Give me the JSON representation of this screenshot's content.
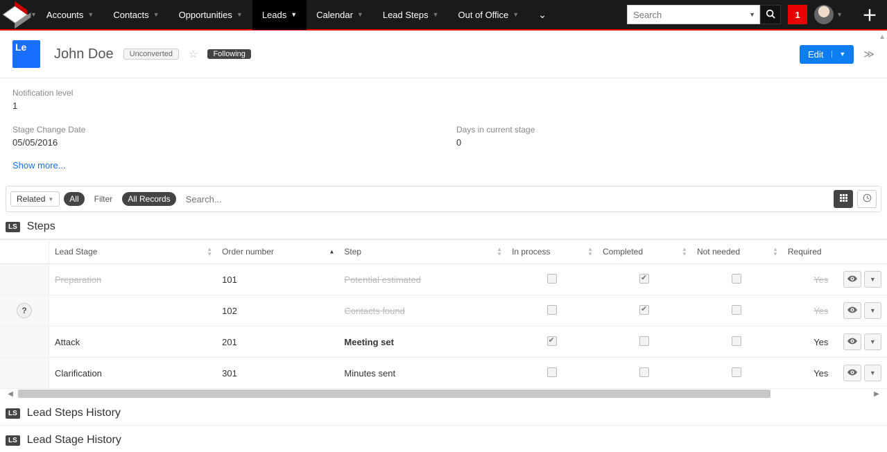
{
  "topnav": {
    "items": [
      "Accounts",
      "Contacts",
      "Opportunities",
      "Leads",
      "Calendar",
      "Lead Steps",
      "Out of Office"
    ],
    "active_index": 3,
    "search_placeholder": "Search",
    "notif_count": "1"
  },
  "record": {
    "type_abbrev": "Le",
    "name": "John Doe",
    "status_tag": "Unconverted",
    "following_tag": "Following",
    "edit_label": "Edit"
  },
  "fields": {
    "notification_level": {
      "label": "Notification level",
      "value": "1"
    },
    "stage_change_date": {
      "label": "Stage Change Date",
      "value": "05/05/2016"
    },
    "days_in_stage": {
      "label": "Days in current stage",
      "value": "0"
    },
    "show_more": "Show more..."
  },
  "filterbar": {
    "related": "Related",
    "all": "All",
    "filter": "Filter",
    "all_records": "All Records",
    "search_placeholder": "Search..."
  },
  "steps": {
    "badge": "LS",
    "title": "Steps",
    "columns": [
      "Lead Stage",
      "Order number",
      "Step",
      "In process",
      "Completed",
      "Not needed",
      "Required"
    ],
    "rows": [
      {
        "gutter": "",
        "stage": "Preparation",
        "order": "101",
        "step": "Potential estimated",
        "in_process": false,
        "completed": true,
        "not_needed": false,
        "required": "Yes",
        "struck": true,
        "bold": false
      },
      {
        "gutter": "info",
        "stage": "",
        "order": "102",
        "step": "Contacts found",
        "in_process": false,
        "completed": true,
        "not_needed": false,
        "required": "Yes",
        "struck": true,
        "bold": false
      },
      {
        "gutter": "",
        "stage": "Attack",
        "order": "201",
        "step": "Meeting set",
        "in_process": true,
        "completed": false,
        "not_needed": false,
        "required": "Yes",
        "struck": false,
        "bold": true
      },
      {
        "gutter": "",
        "stage": "Clarification",
        "order": "301",
        "step": "Minutes sent",
        "in_process": false,
        "completed": false,
        "not_needed": false,
        "required": "Yes",
        "struck": false,
        "bold": false
      }
    ]
  },
  "sections": {
    "history1": {
      "badge": "LS",
      "title": "Lead Steps History"
    },
    "history2": {
      "badge": "LS",
      "title": "Lead Stage History"
    }
  }
}
